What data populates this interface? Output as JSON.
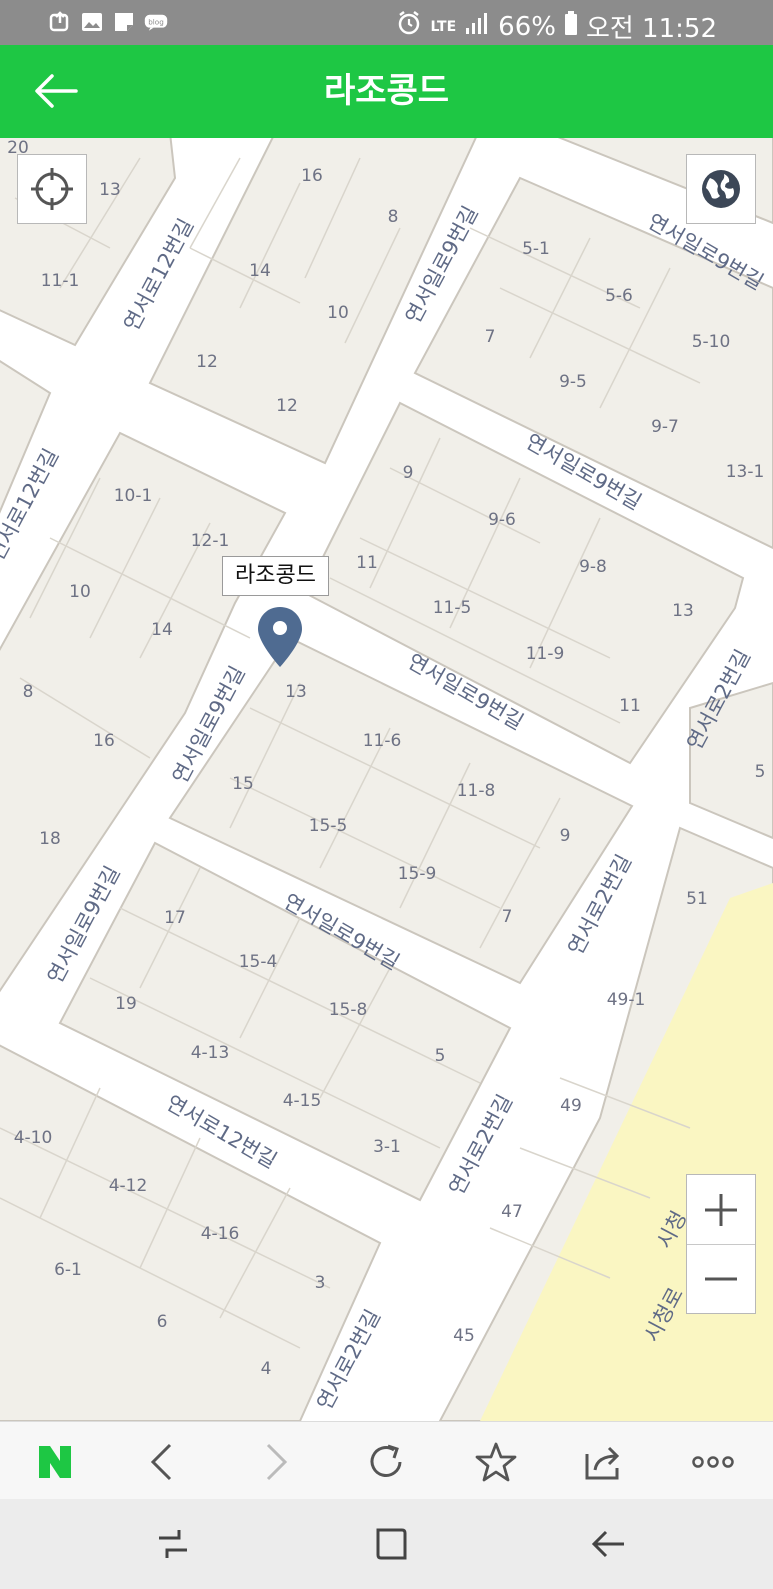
{
  "status_bar": {
    "icons": [
      "upload-icon",
      "gallery-icon",
      "note-icon",
      "blog-icon"
    ],
    "blog_text": "blog",
    "network": "LTE",
    "battery": "66%",
    "time": "오전 11:52"
  },
  "header": {
    "title": "라조콩드",
    "background": "#1ec744"
  },
  "map": {
    "place_label": "라조콩드",
    "land_color": "#f1efe9",
    "road_color": "#ffffff",
    "park_color": "#faf6c2",
    "building_numbers": [
      "20",
      "13",
      "11-1",
      "16",
      "8",
      "14",
      "10",
      "12",
      "12",
      "5-1",
      "5-6",
      "7",
      "5-10",
      "9-5",
      "9-7",
      "13-1",
      "10-1",
      "12-1",
      "10",
      "14",
      "8",
      "16",
      "18",
      "9",
      "9-6",
      "11",
      "11-5",
      "9-8",
      "13",
      "11-9",
      "11",
      "13",
      "11-6",
      "15",
      "15-5",
      "11-8",
      "9",
      "15-9",
      "7",
      "17",
      "15-4",
      "19",
      "15-8",
      "4-13",
      "5",
      "4-15",
      "3-1",
      "51",
      "49-1",
      "49",
      "47",
      "45",
      "4-10",
      "4-12",
      "4-16",
      "6-1",
      "3",
      "6",
      "4",
      "5"
    ],
    "street_names": {
      "yeonseo_12": "연서로12번길",
      "yeonseoil_9": "연서일로9번길",
      "yeonseo_2": "연서로2번길",
      "sicheong": "시청로",
      "sicheong_partial": "시청"
    },
    "controls": {
      "location": "crosshair-icon",
      "globe": "globe-icon",
      "zoom_in": "+",
      "zoom_out": "−"
    }
  },
  "browser_toolbar": {
    "logo": "N",
    "logo_color": "#1ec744",
    "items": [
      "back",
      "forward",
      "refresh",
      "bookmark",
      "share",
      "more"
    ]
  },
  "nav_bar": {
    "items": [
      "recent-apps",
      "home",
      "back"
    ]
  }
}
